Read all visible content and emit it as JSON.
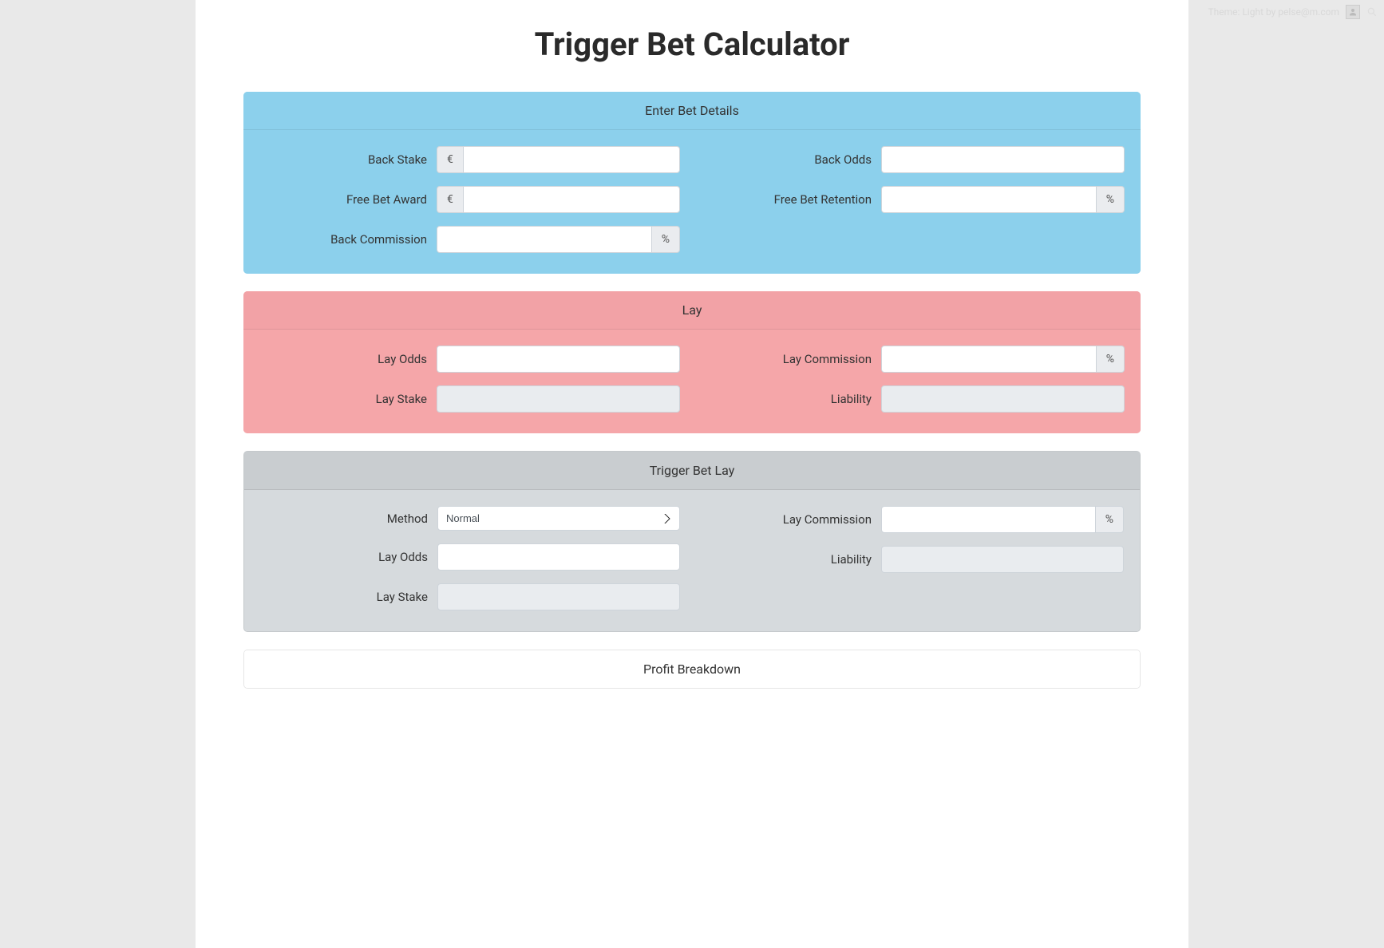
{
  "topbar": {
    "credit": "Theme: Light by pelse@m.com"
  },
  "page": {
    "title": "Trigger Bet Calculator"
  },
  "sections": {
    "bet_details": {
      "header": "Enter Bet Details",
      "currency": "€",
      "percent": "%",
      "back_stake_label": "Back Stake",
      "back_odds_label": "Back Odds",
      "free_bet_award_label": "Free Bet Award",
      "free_bet_retention_label": "Free Bet Retention",
      "back_commission_label": "Back Commission"
    },
    "lay": {
      "header": "Lay",
      "percent": "%",
      "lay_odds_label": "Lay Odds",
      "lay_commission_label": "Lay Commission",
      "lay_stake_label": "Lay Stake",
      "liability_label": "Liability"
    },
    "trigger_lay": {
      "header": "Trigger Bet Lay",
      "percent": "%",
      "method_label": "Method",
      "method_value": "Normal",
      "lay_commission_label": "Lay Commission",
      "lay_odds_label": "Lay Odds",
      "liability_label": "Liability",
      "lay_stake_label": "Lay Stake"
    },
    "profit": {
      "header": "Profit Breakdown"
    }
  }
}
